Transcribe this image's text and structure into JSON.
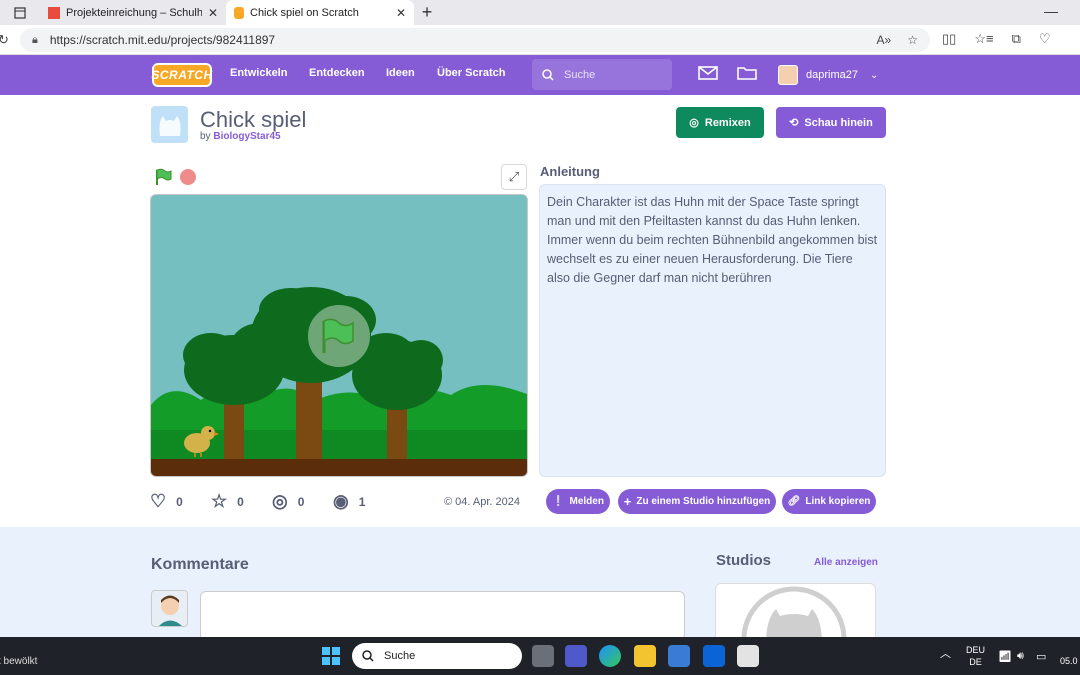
{
  "browser": {
    "tabs": [
      {
        "title": "Projekteinreichung – Schulhackath",
        "active": false
      },
      {
        "title": "Chick spiel on Scratch",
        "active": true
      }
    ],
    "url": "https://scratch.mit.edu/projects/982411897"
  },
  "nav": {
    "logo": "SCRATCH",
    "links": [
      "Entwickeln",
      "Entdecken",
      "Ideen",
      "Über Scratch"
    ],
    "search_placeholder": "Suche",
    "username": "daprima27"
  },
  "project": {
    "title": "Chick spiel",
    "by_label": "by",
    "author": "BiologyStar45",
    "remix_label": "Remixen",
    "see_inside_label": "Schau hinein",
    "instructions_title": "Anleitung",
    "instructions": "Dein Charakter ist das Huhn mit der Space Taste springt man und mit den Pfeiltasten kannst du das Huhn lenken. Immer wenn du beim rechten Bühnenbild angekommen bist wechselt es zu einer neuen Herausforderung. Die Tiere also die Gegner darf man nicht berühren",
    "stats": {
      "loves": "0",
      "favorites": "0",
      "remixes": "0",
      "views": "1"
    },
    "date": "04. Apr. 2024",
    "actions": {
      "report": "Melden",
      "add_studio": "Zu einem Studio hinzufügen",
      "copy_link": "Link kopieren"
    }
  },
  "comments": {
    "title": "Kommentare"
  },
  "studios": {
    "title": "Studios",
    "view_all": "Alle anzeigen"
  },
  "taskbar": {
    "weather": "t bewölkt",
    "search_label": "Suche",
    "lang_line1": "DEU",
    "lang_line2": "DE",
    "clock": "05.0"
  },
  "colors": {
    "scratch_purple": "#855cd6",
    "remix_green": "#0f8a5f",
    "stage_sky": "#75bfc0"
  }
}
